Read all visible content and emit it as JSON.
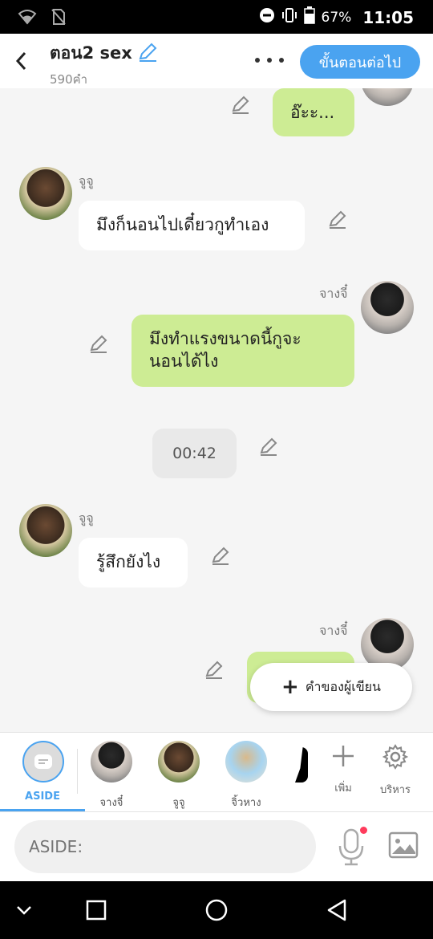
{
  "status_bar": {
    "battery": "67%",
    "time": "11:05"
  },
  "header": {
    "title": "ตอน2 sex",
    "subtitle": "590คำ",
    "next_button": "ขั้นตอนต่อไป"
  },
  "messages": [
    {
      "side": "right",
      "sender": "",
      "text": "อ๊ะะ...",
      "avatar": "jg"
    },
    {
      "side": "left",
      "sender": "จูจู",
      "text": "มึงก็นอนไปเดี๋ยวกูทำเอง",
      "avatar": "jj"
    },
    {
      "side": "right",
      "sender": "จางจี๋",
      "text": "มึงทำแรงขนาดนี้กูจะ นอนได้ไง",
      "avatar": "jg"
    },
    {
      "side": "system",
      "sender": "",
      "text": "00:42"
    },
    {
      "side": "left",
      "sender": "จูจู",
      "text": "รู้สึกยังไง",
      "avatar": "jj"
    },
    {
      "side": "right",
      "sender": "จางจี๋",
      "text": "",
      "avatar": "jg"
    }
  ],
  "float_button": {
    "label": "คำของผู้เขียน"
  },
  "character_bar": {
    "aside_label": "ASIDE",
    "characters": [
      {
        "name": "จางจี๋",
        "avatar": "jg"
      },
      {
        "name": "จูจู",
        "avatar": "jj"
      },
      {
        "name": "จิ้วหาง",
        "avatar": "jh"
      }
    ],
    "add_label": "เพิ่ม",
    "manage_label": "บริหาร"
  },
  "input": {
    "placeholder": "ASIDE:"
  },
  "colors": {
    "accent": "#4aa3f0",
    "bubble_right": "#cdec94",
    "bubble_left": "#ffffff",
    "system_bubble": "#e9e9e9"
  }
}
